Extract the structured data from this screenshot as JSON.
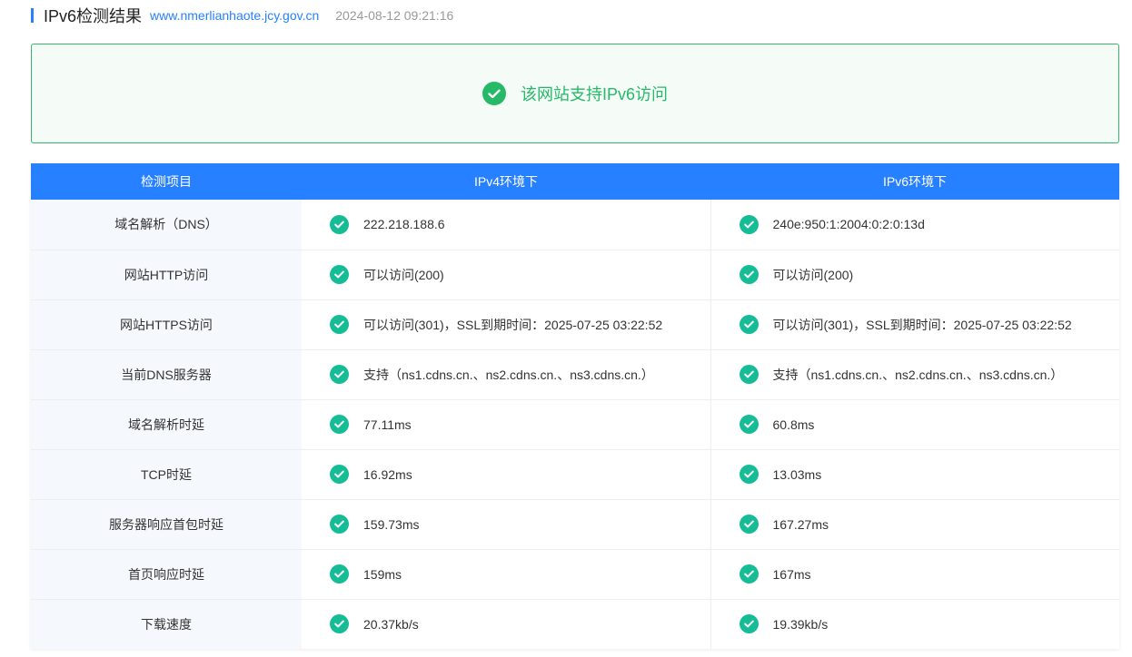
{
  "header": {
    "title": "IPv6检测结果",
    "url": "www.nmerlianhaote.jcy.gov.cn",
    "timestamp": "2024-08-12 09:21:16"
  },
  "result": {
    "message": "该网站支持IPv6访问",
    "icon": "check-circle-icon",
    "color": "#26b967"
  },
  "table": {
    "headers": [
      "检测项目",
      "IPv4环境下",
      "IPv6环境下"
    ],
    "header_color": "#2680ff",
    "check_color": "#15bc96",
    "rows": [
      {
        "item": "域名解析（DNS）",
        "ipv4": "222.218.188.6",
        "ipv6": "240e:950:1:2004:0:2:0:13d"
      },
      {
        "item": "网站HTTP访问",
        "ipv4": "可以访问(200)",
        "ipv6": "可以访问(200)"
      },
      {
        "item": "网站HTTPS访问",
        "ipv4": "可以访问(301)，SSL到期时间：2025-07-25 03:22:52",
        "ipv6": "可以访问(301)，SSL到期时间：2025-07-25 03:22:52"
      },
      {
        "item": "当前DNS服务器",
        "ipv4": "支持（ns1.cdns.cn.、ns2.cdns.cn.、ns3.cdns.cn.）",
        "ipv6": "支持（ns1.cdns.cn.、ns2.cdns.cn.、ns3.cdns.cn.）"
      },
      {
        "item": "域名解析时延",
        "ipv4": "77.11ms",
        "ipv6": "60.8ms"
      },
      {
        "item": "TCP时延",
        "ipv4": "16.92ms",
        "ipv6": "13.03ms"
      },
      {
        "item": "服务器响应首包时延",
        "ipv4": "159.73ms",
        "ipv6": "167.27ms"
      },
      {
        "item": "首页响应时延",
        "ipv4": "159ms",
        "ipv6": "167ms"
      },
      {
        "item": "下载速度",
        "ipv4": "20.37kb/s",
        "ipv6": "19.39kb/s"
      }
    ]
  }
}
